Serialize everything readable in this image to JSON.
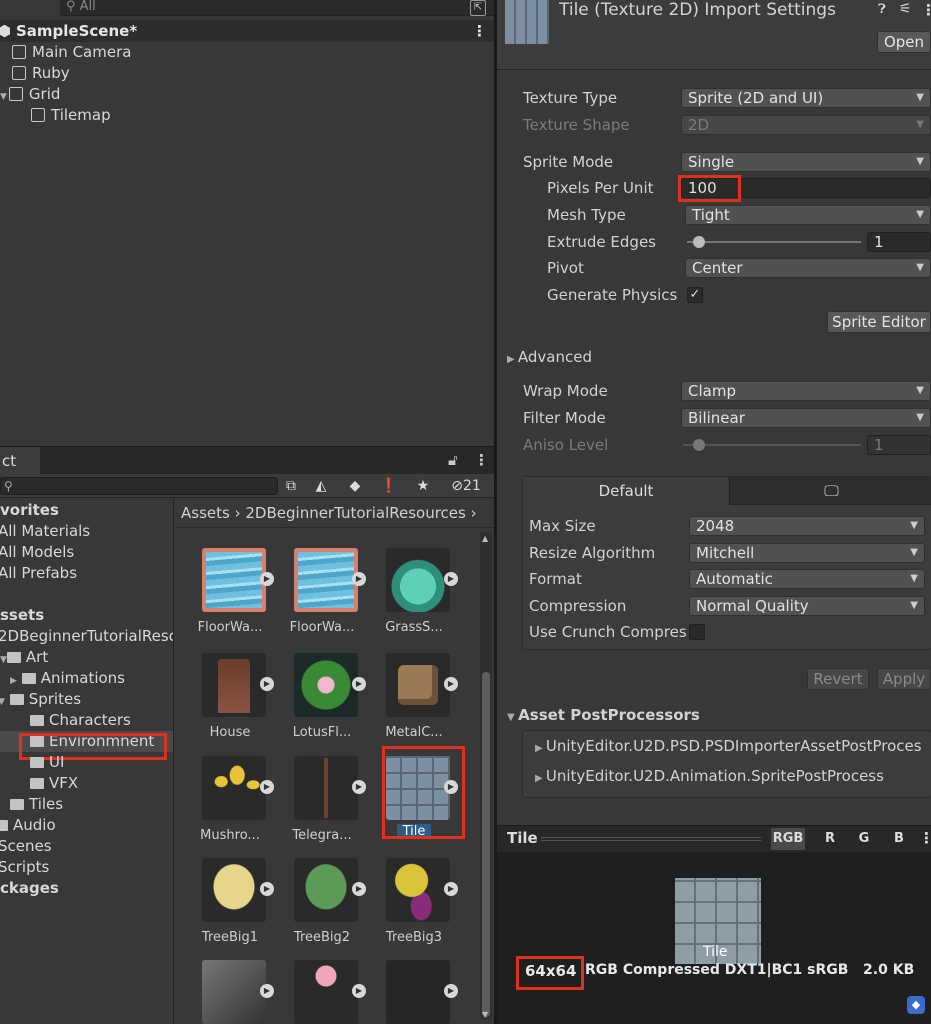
{
  "hierarchy": {
    "search_placeholder": "All",
    "scene_name": "SampleScene*",
    "items": [
      "Main Camera",
      "Ruby",
      "Grid",
      "Tilemap"
    ]
  },
  "project": {
    "tab_label": "ct",
    "hidden_count": "21",
    "favorites": {
      "header": "vorites",
      "items": [
        "All Materials",
        "All Models",
        "All Prefabs"
      ]
    },
    "tree": {
      "assets_header": "ssets",
      "root": "2DBeginnerTutorialResc",
      "art": "Art",
      "animations": "Animations",
      "sprites": "Sprites",
      "characters": "Characters",
      "environment": "Environmnent",
      "ui": "UI",
      "vfx": "VFX",
      "tiles": "Tiles",
      "audio": "Audio",
      "scenes": "Scenes",
      "scripts": "Scripts",
      "packages": "ckages"
    },
    "breadcrumb": [
      "Assets",
      "2DBeginnerTutorialResources"
    ],
    "assets": [
      {
        "name": "FloorWa...",
        "thumb": "floor-water-1"
      },
      {
        "name": "FloorWa...",
        "thumb": "floor-water-2"
      },
      {
        "name": "GrassS...",
        "thumb": "grass"
      },
      {
        "name": "House",
        "thumb": "house"
      },
      {
        "name": "LotusFl...",
        "thumb": "lotus"
      },
      {
        "name": "MetalC...",
        "thumb": "metal-cube"
      },
      {
        "name": "Mushro...",
        "thumb": "mushroom"
      },
      {
        "name": "Telegra...",
        "thumb": "telegraph"
      },
      {
        "name": "Tile",
        "thumb": "tile"
      },
      {
        "name": "TreeBig1",
        "thumb": "tree-yellow"
      },
      {
        "name": "TreeBig2",
        "thumb": "tree-green"
      },
      {
        "name": "TreeBig3",
        "thumb": "tree-purple"
      }
    ]
  },
  "inspector": {
    "title": "Tile (Texture 2D) Import Settings",
    "open_label": "Open",
    "texture_type": {
      "label": "Texture Type",
      "value": "Sprite (2D and UI)"
    },
    "texture_shape": {
      "label": "Texture Shape",
      "value": "2D"
    },
    "sprite_mode": {
      "label": "Sprite Mode",
      "value": "Single"
    },
    "pixels_per_unit": {
      "label": "Pixels Per Unit",
      "value": "100"
    },
    "mesh_type": {
      "label": "Mesh Type",
      "value": "Tight"
    },
    "extrude_edges": {
      "label": "Extrude Edges",
      "value": "1"
    },
    "pivot": {
      "label": "Pivot",
      "value": "Center"
    },
    "generate_physics": {
      "label": "Generate Physics S",
      "checked": true
    },
    "sprite_editor_label": "Sprite Editor",
    "advanced_label": "Advanced",
    "wrap_mode": {
      "label": "Wrap Mode",
      "value": "Clamp"
    },
    "filter_mode": {
      "label": "Filter Mode",
      "value": "Bilinear"
    },
    "aniso_level": {
      "label": "Aniso Level",
      "value": "1"
    },
    "platform": {
      "default_tab": "Default",
      "max_size": {
        "label": "Max Size",
        "value": "2048"
      },
      "resize_algorithm": {
        "label": "Resize Algorithm",
        "value": "Mitchell"
      },
      "format": {
        "label": "Format",
        "value": "Automatic"
      },
      "compression": {
        "label": "Compression",
        "value": "Normal Quality"
      },
      "use_crunch": {
        "label": "Use Crunch Compres",
        "checked": false
      }
    },
    "revert_label": "Revert",
    "apply_label": "Apply",
    "postprocessors": {
      "header": "Asset PostProcessors",
      "items": [
        "UnityEditor.U2D.PSD.PSDImporterAssetPostProces",
        "UnityEditor.U2D.Animation.SpritePostProcess"
      ]
    },
    "preview": {
      "title": "Tile",
      "channels": [
        "RGB",
        "R",
        "G",
        "B"
      ],
      "image_label": "Tile",
      "size": "64x64",
      "info": "RGB Compressed DXT1|BC1 sRGB   2.0 KB"
    }
  },
  "colors": {
    "highlight": "#e0301e",
    "selection": "#2c5d87",
    "panel": "#383838"
  }
}
